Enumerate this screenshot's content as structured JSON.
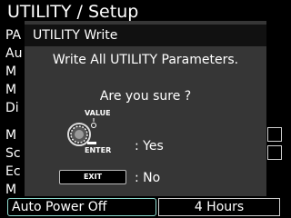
{
  "page": {
    "title": "UTILITY / Setup"
  },
  "background_menu": {
    "visible_fragments": [
      "PA",
      "Au",
      "M",
      "M",
      "Di",
      "M",
      "Sc",
      "Ec",
      "M"
    ]
  },
  "auto_power_off": {
    "label": "Auto Power Off",
    "value": "4 Hours"
  },
  "dialog": {
    "title": "UTILITY Write",
    "message": "Write All UTILITY Parameters.",
    "question": "Are you sure ?",
    "value_knob_label": "VALUE",
    "enter_label": "ENTER",
    "yes_label": ": Yes",
    "exit_button_label": "EXIT",
    "no_label": ": No"
  },
  "colors": {
    "dialog_bg": "#363636",
    "header_bg": "#111111",
    "highlight_border": "#8fdcd0"
  }
}
